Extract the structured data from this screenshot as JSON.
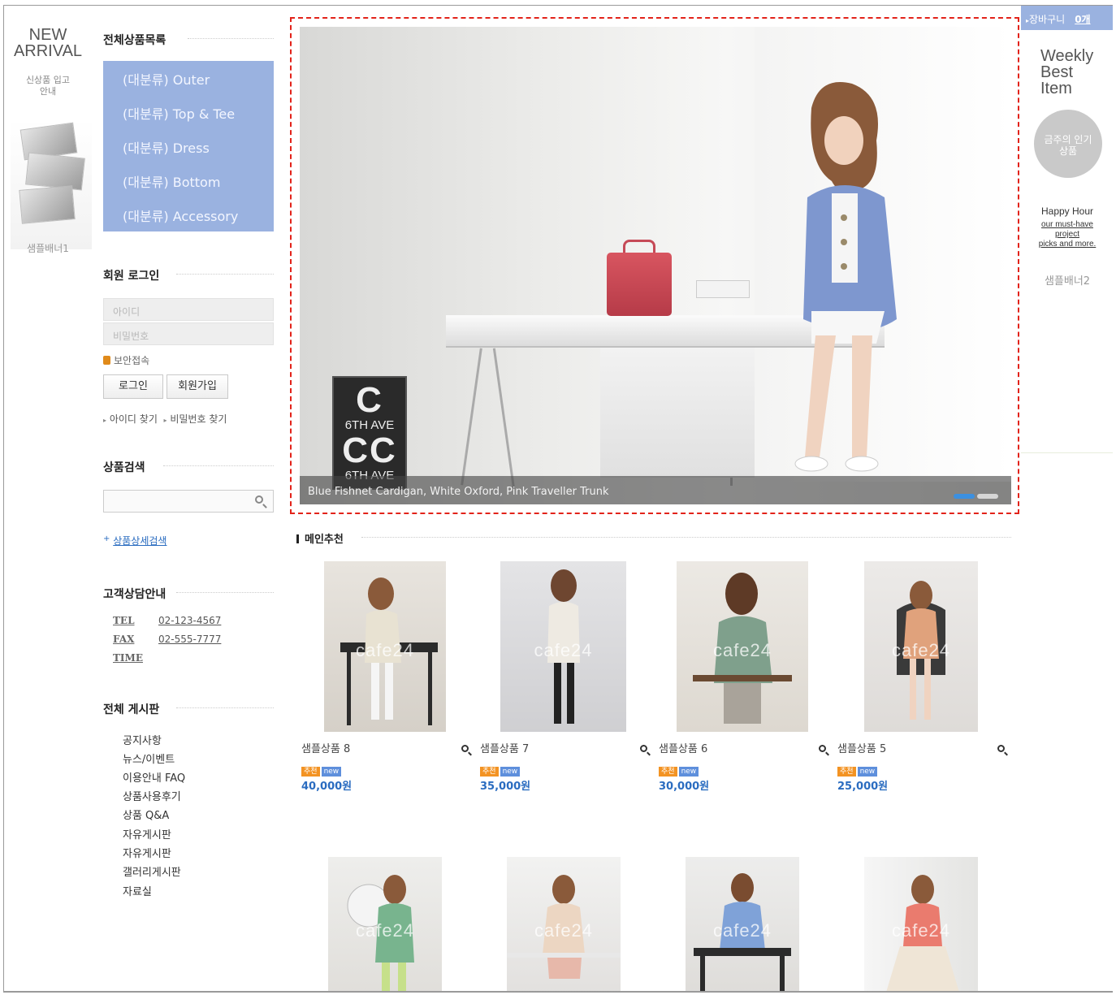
{
  "left_banner": {
    "new_arrival": "NEW\nARRIVAL",
    "new_arrival_sub": "신상품 입고\n안내",
    "sample_banner": "샘플배너1"
  },
  "category": {
    "title": "전체상품목록",
    "items": [
      "(대분류) Outer",
      "(대분류) Top & Tee",
      "(대분류) Dress",
      "(대분류) Bottom",
      "(대분류) Accessory"
    ]
  },
  "login": {
    "title": "회원 로그인",
    "id_placeholder": "아이디",
    "pw_placeholder": "비밀번호",
    "secure": "보안접속",
    "login_btn": "로그인",
    "join_btn": "회원가입",
    "find_id": "아이디 찾기",
    "find_pw": "비밀번호 찾기"
  },
  "search": {
    "title": "상품검색",
    "advanced": "상품상세검색"
  },
  "cs": {
    "title": "고객상담안내",
    "tel_label": "TEL",
    "tel": "02-123-4567",
    "fax_label": "FAX",
    "fax": "02-555-7777",
    "time_label": "TIME"
  },
  "boards": {
    "title": "전체 게시판",
    "items": [
      "공지사항",
      "뉴스/이벤트",
      "이용안내 FAQ",
      "상품사용후기",
      "상품 Q&A",
      "자유게시판",
      "자유게시판",
      "갤러리게시판",
      "자료실"
    ]
  },
  "slider": {
    "caption": "Blue Fishnet Cardigan, White Oxford, Pink Traveller Trunk",
    "poster_c": "C",
    "poster_cc": "CC",
    "poster_ave": "6TH AVE"
  },
  "main_rec": {
    "title": "메인추천",
    "watermark": "cafe24",
    "products": [
      {
        "name": "샘플상품 8",
        "badge1": "추천",
        "badge2": "new",
        "price": "40,000원"
      },
      {
        "name": "샘플상품 7",
        "badge1": "추천",
        "badge2": "new",
        "price": "35,000원"
      },
      {
        "name": "샘플상품 6",
        "badge1": "추천",
        "badge2": "new",
        "price": "30,000원"
      },
      {
        "name": "샘플상품 5",
        "badge1": "추천",
        "badge2": "new",
        "price": "25,000원"
      }
    ]
  },
  "right": {
    "cart_label": "장바구니",
    "cart_count": "0개",
    "weekly": "Weekly\nBest\nItem",
    "popular": "금주의 인기\n상품",
    "happy_title": "Happy Hour",
    "happy_sub": "our must-have\nproject\npicks and more.",
    "sample_banner": "샘플배너2"
  },
  "colors": {
    "category_bg": "#9ab2e0",
    "price": "#2a6cc0",
    "highlight_border": "#e2231a",
    "badge_recommend": "#f39323",
    "badge_new": "#5e8fdc"
  }
}
